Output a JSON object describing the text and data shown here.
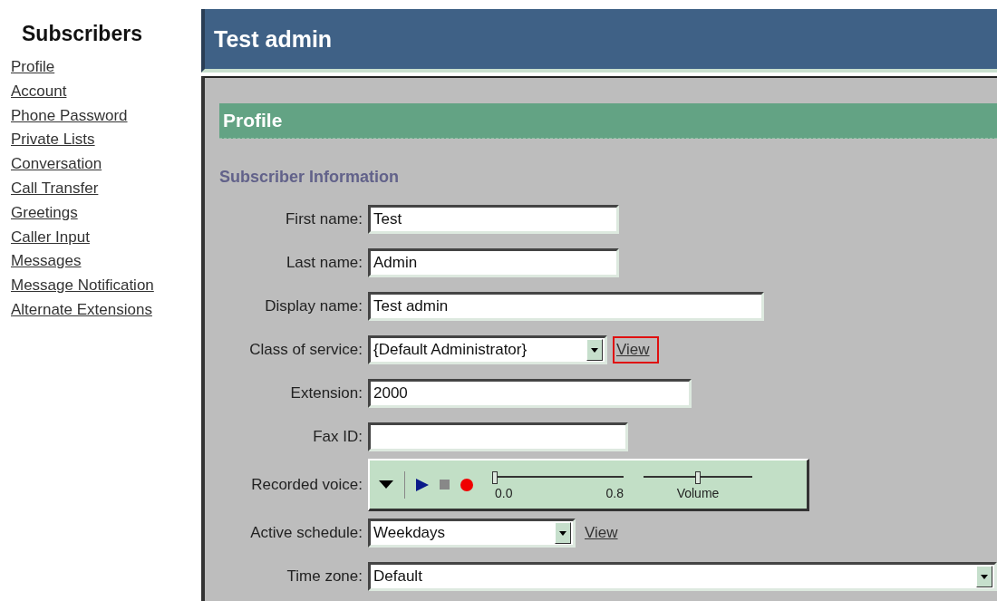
{
  "sidebar": {
    "title": "Subscribers",
    "links": [
      "Profile",
      "Account",
      "Phone Password",
      "Private Lists",
      "Conversation",
      "Call Transfer",
      "Greetings",
      "Caller Input",
      "Messages",
      "Message Notification",
      "Alternate Extensions"
    ]
  },
  "header": {
    "title": "Test admin"
  },
  "section": {
    "title": "Profile"
  },
  "group": {
    "title": "Subscriber Information"
  },
  "fields": [
    {
      "kind": "text",
      "label": "First name:",
      "value": "Test"
    },
    {
      "kind": "text",
      "label": "Last name:",
      "value": "Admin"
    },
    {
      "kind": "text",
      "label": "Display name:",
      "value": "Test admin"
    },
    {
      "kind": "select",
      "label": "Class of service:",
      "value": "{Default Administrator}",
      "link": {
        "text": "View",
        "highlighted": true
      }
    },
    {
      "kind": "text",
      "label": "Extension:",
      "value": "2000"
    },
    {
      "kind": "text",
      "label": "Fax ID:"
    },
    {
      "kind": "player",
      "label": "Recorded voice:",
      "position": {
        "level": 0,
        "start": "0.0",
        "end": "0.8"
      },
      "volume": {
        "level": 0.5,
        "label": "Volume"
      }
    },
    {
      "kind": "select",
      "label": "Active schedule:",
      "value": "Weekdays",
      "link": {
        "text": "View",
        "highlighted": false
      }
    },
    {
      "kind": "select",
      "label": "Time zone:",
      "value": "Default"
    }
  ]
}
